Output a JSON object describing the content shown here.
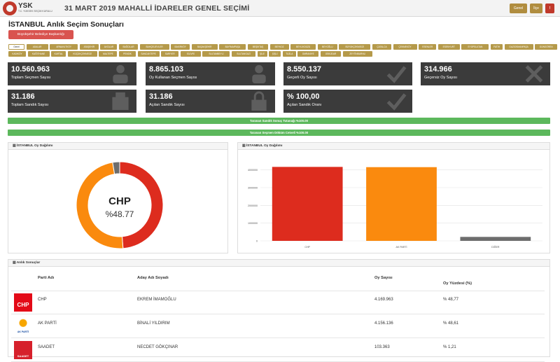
{
  "header": {
    "logo_text": "YSK",
    "logo_subtitle": "T.C. YÜKSEK SEÇİM KURULU",
    "election_title": "31 MART 2019 MAHALLİ İDARELER GENEL SEÇİMİ",
    "btn_genel": "Genel",
    "btn_ilce": "İlçe",
    "btn_red": "!"
  },
  "page": {
    "title": "İSTANBUL Anlık Seçim Sonuçları",
    "main_button": "Büyükşehir Belediye Başkanlığı"
  },
  "districts": [
    "Genel",
    "ADALAR",
    "ARNAVUTKÖY",
    "ATAŞEHİR",
    "AVCILAR",
    "BAĞCILAR",
    "BAHÇELİEVLER",
    "BAKIRKÖY",
    "BAŞAKŞEHİR",
    "BAYRAMPAŞA",
    "BEŞİKTAŞ",
    "BEYKOZ",
    "BEYLİKDÜZÜ",
    "BEYOĞLU",
    "BÜYÜKÇEKMECE",
    "ÇATALCA",
    "ÇEKMEKÖY",
    "ESENLER",
    "ESENYURT",
    "EYÜPSULTAN",
    "FATİH",
    "GAZİOSMANPAŞA",
    "GÜNGÖREN",
    "KADIKÖY",
    "KAĞITHANE",
    "KARTAL",
    "KÜÇÜKÇEKMECE",
    "MALTEPE",
    "PENDİK",
    "SANCAKTEPE",
    "SARIYER",
    "SİLİVRİ",
    "SULTANBEYLİ",
    "SULTANGAZİ",
    "ŞİLE",
    "ŞİŞLİ",
    "TUZLA",
    "ÜMRANİYE",
    "ÜSKÜDAR",
    "ZEYTİNBURNU"
  ],
  "stats": [
    {
      "value": "10.560.963",
      "label": "Toplam Seçmen Sayısı",
      "icon": "people-icon"
    },
    {
      "value": "8.865.103",
      "label": "Oy Kullanan Seçmen Sayısı",
      "icon": "person-icon"
    },
    {
      "value": "8.550.137",
      "label": "Geçerli Oy Sayısı",
      "icon": "check-icon"
    },
    {
      "value": "314.966",
      "label": "Geçersiz Oy Sayısı",
      "icon": "x-icon"
    },
    {
      "value": "31.186",
      "label": "Toplam Sandık Sayısı",
      "icon": "box-icon"
    },
    {
      "value": "31.186",
      "label": "Açılan Sandık Sayısı",
      "icon": "lock-icon"
    },
    {
      "value": "% 100,00",
      "label": "Açılan Sandık Oranı",
      "icon": "check-icon"
    }
  ],
  "progress": {
    "bar1_label": "Taranan Sandık Sonuç Tutanağı %100.00",
    "bar2_label": "Taranan Seçmen Döküm Cetveli %100.00"
  },
  "donut_panel": {
    "title": "İSTANBUL Oy Dağılımı",
    "center_party": "CHP",
    "center_pct": "%48.77"
  },
  "bar_panel": {
    "title": "İSTANBUL Oy Dağılımı"
  },
  "chart_data": [
    {
      "type": "pie",
      "variant": "donut",
      "labels": [
        "CHP",
        "AK PARTİ",
        "DİĞER"
      ],
      "values": [
        48.77,
        48.61,
        2.62
      ],
      "colors": [
        "#dd2c1e",
        "#fa8a0e",
        "#6d6d6d"
      ]
    },
    {
      "type": "bar",
      "categories": [
        "CHP",
        "AK PARTİ",
        "DİĞER"
      ],
      "values": [
        4169963,
        4156136,
        224038
      ],
      "colors": [
        "#dd2c1e",
        "#fa8a0e",
        "#6d6d6d"
      ],
      "ylim": [
        0,
        4500000
      ],
      "yticks": [
        0,
        1000000,
        2000000,
        3000000,
        4000000
      ],
      "ytick_labels": [
        "0",
        "1000000",
        "2000000",
        "3000000",
        "4000000"
      ]
    }
  ],
  "results": {
    "title": "Anlık Sonuçlar",
    "headers": {
      "party": "Parti Adı",
      "candidate": "Aday Adı Soyadı",
      "votes": "Oy Sayısı",
      "pct": "Oy Yüzdesi (%)"
    },
    "rows": [
      {
        "logo_text": "CHP",
        "party": "CHP",
        "candidate": "EKREM İMAMOĞLU",
        "votes": "4.169.963",
        "pct": "% 48,77",
        "logo": "chp-logo-icon"
      },
      {
        "logo_text": "AK PARTİ",
        "party": "AK PARTİ",
        "candidate": "BİNALİ YILDIRIM",
        "votes": "4.156.136",
        "pct": "% 48,61",
        "logo": "akparti-logo-icon"
      },
      {
        "logo_text": "SAADET",
        "party": "SAADET",
        "candidate": "NECDET GÖKÇINAR",
        "votes": "103.363",
        "pct": "% 1,21",
        "logo": "saadet-logo-icon"
      }
    ]
  }
}
